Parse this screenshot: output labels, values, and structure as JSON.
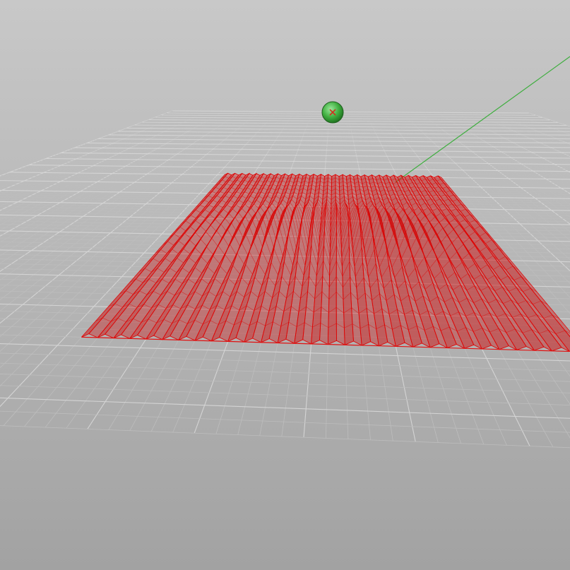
{
  "viewport": {
    "background_top": "#c8c8c8",
    "background_bottom": "#a2a2a2",
    "grid_color": "#bdbdbd",
    "grid_major_color": "#d4d4d4",
    "axis_color": "#3fae3f"
  },
  "surface": {
    "fill_color": "#cc1010",
    "edge_color": "#e00000",
    "baseline_color": "#e01010"
  },
  "attractor_point": {
    "fill_color": "#3fae3f",
    "marker_color": "#d03020"
  }
}
